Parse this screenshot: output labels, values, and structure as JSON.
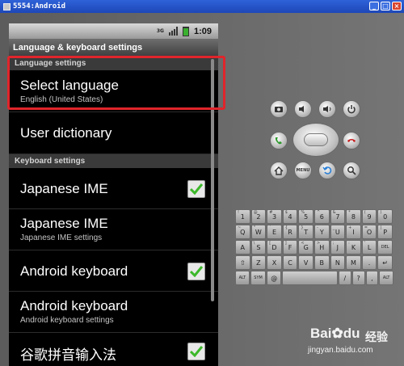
{
  "window": {
    "title": "5554:Android"
  },
  "status_bar": {
    "network": "3G",
    "time": "1:09"
  },
  "app": {
    "title": "Language & keyboard settings"
  },
  "sections": {
    "language": {
      "header": "Language settings"
    },
    "keyboard": {
      "header": "Keyboard settings"
    }
  },
  "items": {
    "select_language": {
      "title": "Select language",
      "summary": "English (United States)"
    },
    "user_dictionary": {
      "title": "User dictionary"
    },
    "japanese_ime_toggle": {
      "title": "Japanese IME",
      "checked": true
    },
    "japanese_ime_settings": {
      "title": "Japanese IME",
      "summary": "Japanese IME settings"
    },
    "android_keyboard_toggle": {
      "title": "Android keyboard",
      "checked": true
    },
    "android_keyboard_settings": {
      "title": "Android keyboard",
      "summary": "Android keyboard settings"
    },
    "google_pinyin": {
      "title": "谷歌拼音输入法",
      "checked": true
    }
  },
  "hardware_buttons": [
    "camera-icon",
    "volume-down-icon",
    "volume-up-icon",
    "power-icon",
    "call-icon",
    "end-call-icon",
    "home-icon",
    "menu-icon",
    "back-icon",
    "search-icon"
  ],
  "hardware_labels": {
    "menu": "MENU"
  },
  "keyboard": {
    "row1": [
      [
        "1",
        "!"
      ],
      [
        "2",
        "@"
      ],
      [
        "3",
        "#"
      ],
      [
        "4",
        "$"
      ],
      [
        "5",
        "%"
      ],
      [
        "6",
        "^"
      ],
      [
        "7",
        "&"
      ],
      [
        "8",
        "*"
      ],
      [
        "9",
        "("
      ],
      [
        "0",
        ")"
      ]
    ],
    "row2": [
      [
        "Q",
        "~"
      ],
      [
        "W",
        "\""
      ],
      [
        "E",
        "`"
      ],
      [
        "R",
        "{"
      ],
      [
        "T",
        "}"
      ],
      [
        "Y",
        "-"
      ],
      [
        "U",
        "_"
      ],
      [
        "I",
        "+"
      ],
      [
        "O",
        "="
      ],
      [
        "P",
        "|"
      ]
    ],
    "row3": [
      [
        "A",
        ""
      ],
      [
        "S",
        "\\"
      ],
      [
        "D",
        "["
      ],
      [
        "F",
        "]"
      ],
      [
        "G",
        "<"
      ],
      [
        "H",
        ">"
      ],
      [
        "J",
        ";"
      ],
      [
        "K",
        ":"
      ],
      [
        "L",
        "'"
      ],
      [
        "DEL",
        ""
      ]
    ],
    "row4": [
      [
        "⇧",
        ""
      ],
      [
        "Z",
        ""
      ],
      [
        "X",
        ""
      ],
      [
        "C",
        ""
      ],
      [
        "V",
        ""
      ],
      [
        "B",
        ""
      ],
      [
        "N",
        ""
      ],
      [
        "M",
        ""
      ],
      [
        ".",
        ""
      ],
      [
        "↵",
        ""
      ]
    ],
    "row5": [
      [
        "ALT",
        ""
      ],
      [
        "SYM",
        ""
      ],
      [
        "@",
        ""
      ],
      [
        "",
        ""
      ],
      [
        "/",
        ""
      ],
      [
        "?",
        ""
      ],
      [
        ",",
        ""
      ],
      [
        "ALT",
        ""
      ]
    ]
  },
  "watermark": {
    "logo": "Bai",
    "logo_suffix": "du",
    "cn": "经验",
    "url": "jingyan.baidu.com"
  },
  "colors": {
    "highlight": "#e0252b",
    "check_green": "#3cb82a"
  }
}
